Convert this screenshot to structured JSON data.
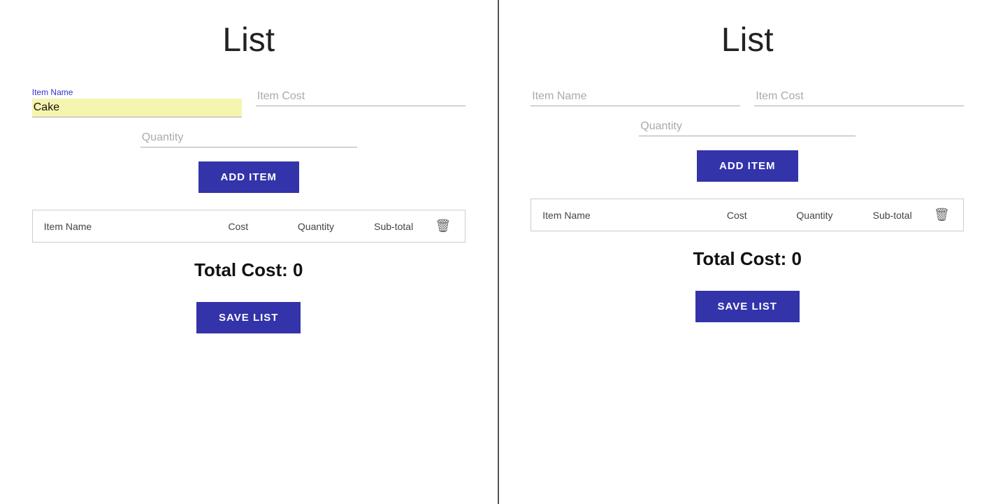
{
  "leftPanel": {
    "title": "List",
    "form": {
      "itemNameLabel": "Item Name",
      "itemNameValue": "Cake",
      "itemNamePlaceholder": "Item Name",
      "itemCostPlaceholder": "Item Cost",
      "quantityPlaceholder": "Quantity"
    },
    "addItemButton": "ADD ITEM",
    "table": {
      "headers": [
        "Item Name",
        "Cost",
        "Quantity",
        "Sub-total"
      ]
    },
    "totalCost": "Total Cost: 0",
    "saveListButton": "SAVE LIST"
  },
  "rightPanel": {
    "title": "List",
    "form": {
      "itemNamePlaceholder": "Item Name",
      "itemCostPlaceholder": "Item Cost",
      "quantityPlaceholder": "Quantity"
    },
    "addItemButton": "ADD ITEM",
    "table": {
      "headers": [
        "Item Name",
        "Cost",
        "Quantity",
        "Sub-total"
      ]
    },
    "totalCost": "Total Cost: 0",
    "saveListButton": "SAVE LIST"
  },
  "icons": {
    "trash": "🗑"
  }
}
